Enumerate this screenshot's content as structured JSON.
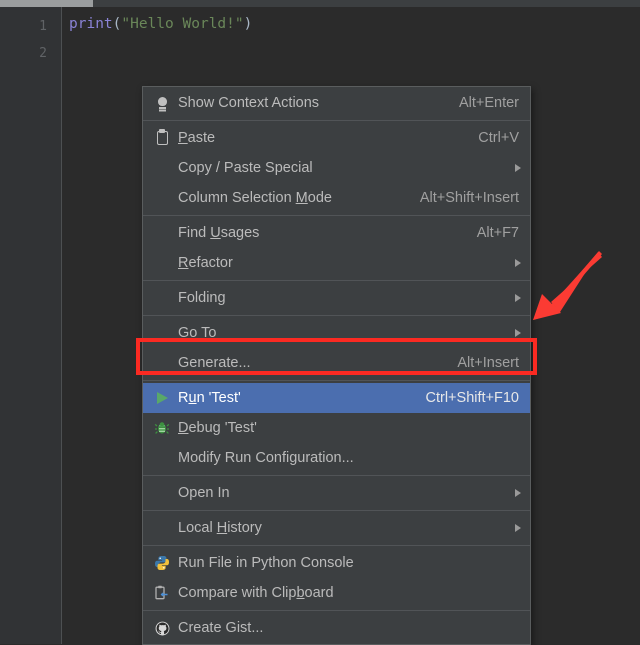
{
  "editor": {
    "gutter": {
      "line_numbers": [
        "1",
        "2"
      ]
    },
    "code": {
      "function_name": "print",
      "open_paren": "(",
      "string_literal": "\"Hello World!\"",
      "close_paren": ")"
    }
  },
  "context_menu": {
    "groups": [
      {
        "items": [
          {
            "label": "Show Context Actions",
            "mnemonic": "",
            "shortcut": "Alt+Enter",
            "icon": "lightbulb-icon",
            "submenu": false,
            "selected": false
          }
        ]
      },
      {
        "items": [
          {
            "label": "Paste",
            "mnemonic": "P",
            "shortcut": "Ctrl+V",
            "icon": "clipboard-paste-icon",
            "submenu": false,
            "selected": false
          },
          {
            "label": "Copy / Paste Special",
            "mnemonic": "",
            "shortcut": "",
            "icon": "",
            "submenu": true,
            "selected": false
          },
          {
            "label": "Column Selection Mode",
            "mnemonic": "M",
            "shortcut": "Alt+Shift+Insert",
            "icon": "",
            "submenu": false,
            "selected": false
          }
        ]
      },
      {
        "items": [
          {
            "label": "Find Usages",
            "mnemonic": "U",
            "shortcut": "Alt+F7",
            "icon": "",
            "submenu": false,
            "selected": false
          },
          {
            "label": "Refactor",
            "mnemonic": "R",
            "shortcut": "",
            "icon": "",
            "submenu": true,
            "selected": false
          }
        ]
      },
      {
        "items": [
          {
            "label": "Folding",
            "mnemonic": "",
            "shortcut": "",
            "icon": "",
            "submenu": true,
            "selected": false
          }
        ]
      },
      {
        "items": [
          {
            "label": "Go To",
            "mnemonic": "",
            "shortcut": "",
            "icon": "",
            "submenu": true,
            "selected": false
          },
          {
            "label": "Generate...",
            "mnemonic": "",
            "shortcut": "Alt+Insert",
            "icon": "",
            "submenu": false,
            "selected": false
          }
        ]
      },
      {
        "items": [
          {
            "label": "Run 'Test'",
            "mnemonic": "u",
            "shortcut": "Ctrl+Shift+F10",
            "icon": "run-play-icon",
            "submenu": false,
            "selected": true
          },
          {
            "label": "Debug 'Test'",
            "mnemonic": "D",
            "shortcut": "",
            "icon": "debug-bug-icon",
            "submenu": false,
            "selected": false
          },
          {
            "label": "Modify Run Configuration...",
            "mnemonic": "",
            "shortcut": "",
            "icon": "",
            "submenu": false,
            "selected": false
          }
        ]
      },
      {
        "items": [
          {
            "label": "Open In",
            "mnemonic": "",
            "shortcut": "",
            "icon": "",
            "submenu": true,
            "selected": false
          }
        ]
      },
      {
        "items": [
          {
            "label": "Local History",
            "mnemonic": "H",
            "shortcut": "",
            "icon": "",
            "submenu": true,
            "selected": false
          }
        ]
      },
      {
        "items": [
          {
            "label": "Run File in Python Console",
            "mnemonic": "",
            "shortcut": "",
            "icon": "python-icon",
            "submenu": false,
            "selected": false
          },
          {
            "label": "Compare with Clipboard",
            "mnemonic": "b",
            "shortcut": "",
            "icon": "compare-clipboard-icon",
            "submenu": false,
            "selected": false
          }
        ]
      },
      {
        "items": [
          {
            "label": "Create Gist...",
            "mnemonic": "",
            "shortcut": "",
            "icon": "github-icon",
            "submenu": false,
            "selected": false
          }
        ]
      }
    ]
  },
  "annotations": {
    "highlight_box": {
      "color": "#fb2a22"
    },
    "arrow": {
      "color": "#fb3b33",
      "direction": "down-left"
    }
  },
  "colors": {
    "editor_bg": "#2b2b2b",
    "gutter_bg": "#313335",
    "menu_bg": "#3c3f41",
    "menu_text": "#bbbbbb",
    "selection_blue": "#4b6eaf",
    "string_green": "#6a8759",
    "function_purple": "#8a83d6",
    "annotation_red": "#fb2a22"
  }
}
